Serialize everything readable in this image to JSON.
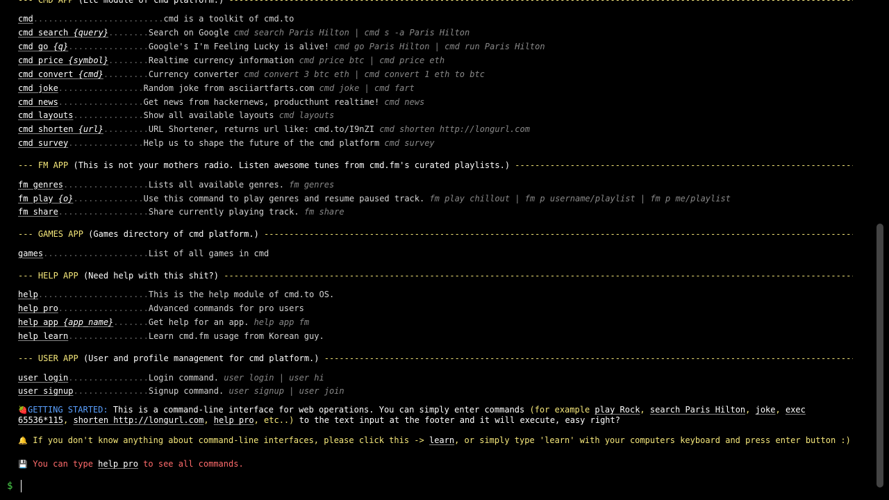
{
  "cmd_app": {
    "app": "CMD APP",
    "desc": "(Etc module of cmd platform.)",
    "items": [
      {
        "cmd": "cmd",
        "arg": "",
        "dots": "..........................",
        "desc": "cmd is a toolkit of cmd.to",
        "ex": ""
      },
      {
        "cmd": "cmd search ",
        "arg": "{query}",
        "dots": "........",
        "desc": "Search on Google ",
        "ex": "cmd search Paris Hilton | cmd s -a Paris Hilton"
      },
      {
        "cmd": "cmd go ",
        "arg": "{q}",
        "dots": "................",
        "desc": "Google's I'm Feeling Lucky is alive! ",
        "ex": "cmd go Paris Hilton | cmd run Paris Hilton"
      },
      {
        "cmd": "cmd price ",
        "arg": "{symbol}",
        "dots": "........",
        "desc": "Realtime currency information ",
        "ex": "cmd price btc | cmd price eth"
      },
      {
        "cmd": "cmd convert ",
        "arg": "{cmd}",
        "dots": ".........",
        "desc": "Currency converter ",
        "ex": "cmd convert 3 btc eth | cmd convert 1 eth to btc"
      },
      {
        "cmd": "cmd joke",
        "arg": "",
        "dots": ".................",
        "desc": "Random joke from asciiartfarts.com ",
        "ex": "cmd joke | cmd fart"
      },
      {
        "cmd": "cmd news",
        "arg": "",
        "dots": ".................",
        "desc": "Get news from hackernews, producthunt realtime! ",
        "ex": "cmd news"
      },
      {
        "cmd": "cmd layouts",
        "arg": "",
        "dots": "..............",
        "desc": "Show all available layouts ",
        "ex": "cmd layouts"
      },
      {
        "cmd": "cmd shorten ",
        "arg": "{url}",
        "dots": ".........",
        "desc": "URL Shortener, returns url like: cmd.to/I9nZI ",
        "ex": "cmd shorten http://longurl.com"
      },
      {
        "cmd": "cmd survey",
        "arg": "",
        "dots": "...............",
        "desc": "Help us to shape the future of the cmd platform ",
        "ex": "cmd survey"
      }
    ]
  },
  "fm_app": {
    "app": "FM APP",
    "desc": "(This is not your mothers radio. Listen awesome tunes from cmd.fm's curated playlists.)",
    "items": [
      {
        "cmd": "fm genres",
        "arg": "",
        "dots": ".................",
        "desc": "Lists all available genres. ",
        "ex": "fm genres"
      },
      {
        "cmd": "fm play ",
        "arg": "{o}",
        "dots": "..............",
        "desc": "Use this command to play genres and resume paused track. ",
        "ex": "fm play chillout | fm p username/playlist | fm p me/playlist"
      },
      {
        "cmd": "fm share",
        "arg": "",
        "dots": "..................",
        "desc": "Share currently playing track. ",
        "ex": "fm share"
      }
    ]
  },
  "games_app": {
    "app": "GAMES APP",
    "desc": "(Games directory of cmd platform.)",
    "items": [
      {
        "cmd": "games",
        "arg": "",
        "dots": ".....................",
        "desc": "List of all games in cmd",
        "ex": ""
      }
    ]
  },
  "help_app": {
    "app": "HELP APP",
    "desc": "(Need help with this shit?)",
    "items": [
      {
        "cmd": "help",
        "arg": "",
        "dots": "......................",
        "desc": "This is the help module of cmd.to OS.",
        "ex": ""
      },
      {
        "cmd": "help pro",
        "arg": "",
        "dots": "..................",
        "desc": "Advanced commands for pro users",
        "ex": ""
      },
      {
        "cmd": "help app ",
        "arg": "{app_name}",
        "dots": ".......",
        "desc": "Get help for an app. ",
        "ex": "help app fm"
      },
      {
        "cmd": "help learn",
        "arg": "",
        "dots": "................",
        "desc": "Learn cmd.fm usage from Korean guy.",
        "ex": ""
      }
    ]
  },
  "user_app": {
    "app": "USER APP",
    "desc": "(User and profile management for cmd platform.)",
    "items": [
      {
        "cmd": "user login",
        "arg": "",
        "dots": "................",
        "desc": "Login command. ",
        "ex": "user login | user hi"
      },
      {
        "cmd": "user signup",
        "arg": "",
        "dots": "...............",
        "desc": "Signup command. ",
        "ex": "user signup | user join"
      }
    ]
  },
  "getting_started": {
    "emoji": "🍓",
    "label": "GETTING STARTED:",
    "t1": " This is a command-line interface for web operations. You can simply enter commands ",
    "p_open": "(for example ",
    "l_rock": "play Rock",
    "sep1": ", ",
    "l_search": "search Paris Hilton",
    "sep2": ", ",
    "l_joke": "joke",
    "sep3": ", ",
    "l_exec": "exec",
    "l_exec2": "65536*115",
    "sep4": ", ",
    "l_shorten": "shorten http://longurl.com",
    "sep5": ", ",
    "l_help": "help pro",
    "p_close": ", etc..)",
    "t2": " to the text input at the footer and it will execute, easy right?"
  },
  "learn_hint": {
    "emoji": "🔔",
    "t1": " If you don't know anything about command-line interfaces, please click this -> ",
    "link": "learn",
    "t2": ", or simply type 'learn' with your computers keyboard and press enter button :)"
  },
  "help_hint": {
    "emoji": "💾",
    "t1": " You can type ",
    "link": "help pro",
    "t2": " to see all commands."
  },
  "prompt": {
    "symbol": "$",
    "value": ""
  },
  "colors": {
    "background": "#000000",
    "app_title": "#f5e77a",
    "prompt": "#4bd04b",
    "label": "#5aa0ff",
    "alert": "#ff6b6b"
  }
}
